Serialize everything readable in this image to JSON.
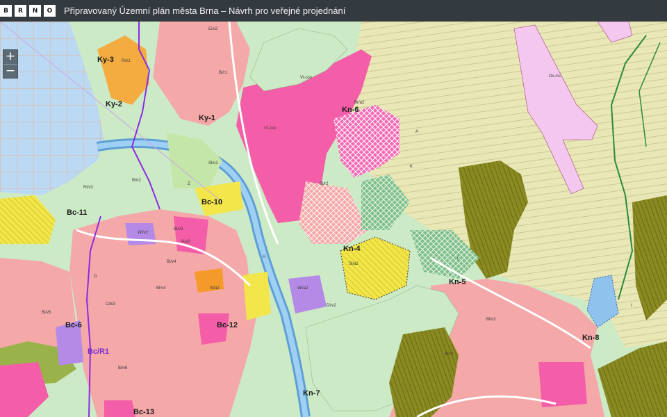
{
  "header": {
    "logo_letters": [
      "B",
      "R",
      "N",
      "O"
    ],
    "title": "Připravovaný Územní plán města Brna – Návrh pro veřejné projednání"
  },
  "zoom": {
    "in_label": "+",
    "out_label": "−"
  },
  "map": {
    "zone_labels": [
      "Ky-3",
      "Ky-2",
      "Ky-1",
      "Kn-6",
      "Bc-11",
      "Bc-10",
      "Kn-4",
      "Kn-5",
      "Bc-6",
      "Bc-12",
      "Bc/R1",
      "Bc-13",
      "Kn-7",
      "Kn-8"
    ],
    "minor_labels": [
      "Vi-zoo",
      "Bi/r1",
      "Bi/r2",
      "Bi/v3",
      "A",
      "K",
      "Z",
      "Dx-/ss",
      "Sl/o1",
      "Wi/v2",
      "Wi/a2",
      "Sl/a2",
      "Vi/a3",
      "Bi/v4",
      "Sl/a2",
      "Cl/k3",
      "Dl/v2",
      "Ei/s2",
      "Ri/r1",
      "Br/a2",
      "H",
      "I",
      "L",
      "D",
      "Vi-zoo",
      "Bi/v5",
      "Bl/r2",
      "Ri/v3",
      "Bl/v3",
      "Bl/v4",
      "Bi/v6",
      "Ri/r2"
    ],
    "colors": {
      "residential": "#f4a8a8",
      "residential_dark": "#ef8f8f",
      "green": "#c9ecc4",
      "agri": "#e6e6b4",
      "pink": "#f45ea8",
      "olive": "#8c8c22",
      "water": "#8fc2ec",
      "reservoir": "#b8d8f4",
      "yellow": "#f4ee4c",
      "orange": "#f4ab40",
      "purple": "#b48ae6",
      "lightpink": "#f4c8ee"
    }
  }
}
